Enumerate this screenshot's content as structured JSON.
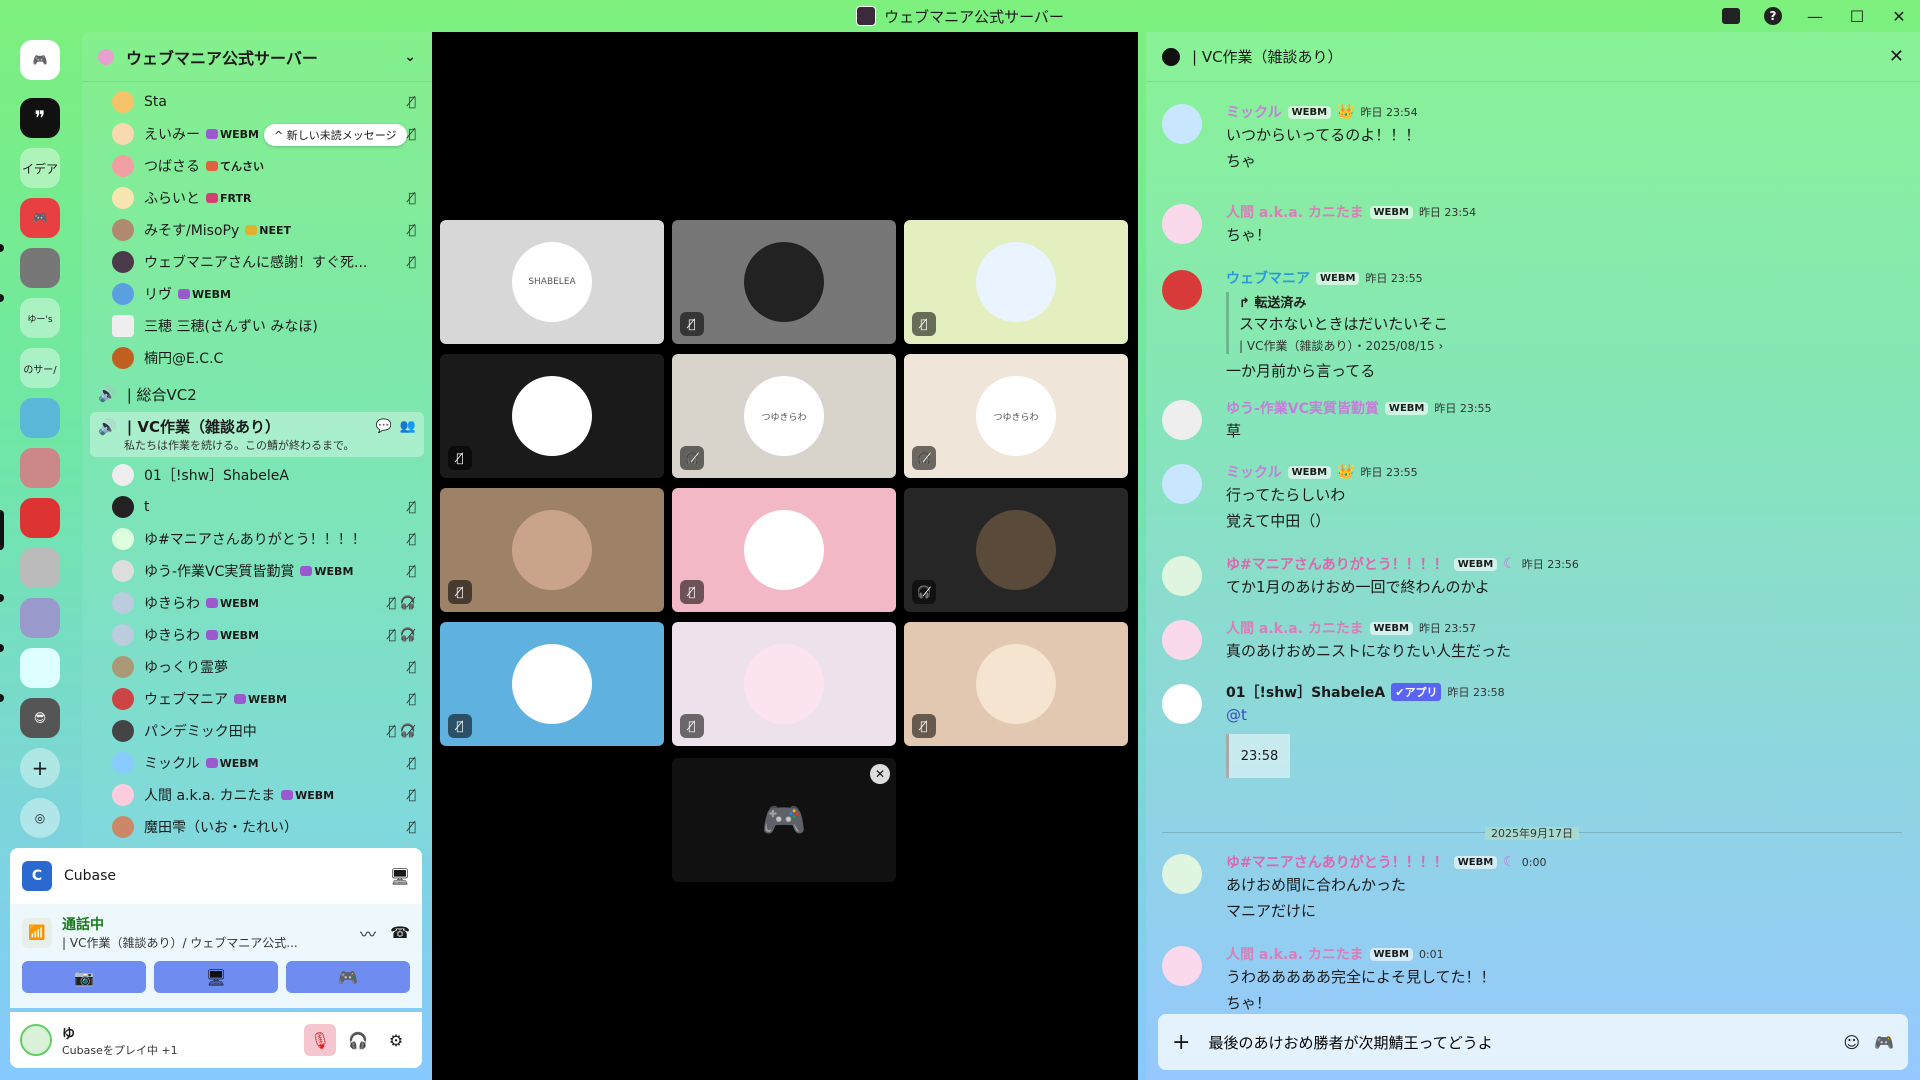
{
  "window": {
    "title": "ウェブマニア公式サーバー"
  },
  "rail": {
    "items": [
      "イデア",
      "ゆー's",
      "のサー/"
    ]
  },
  "server": {
    "name": "ウェブマニア公式サーバー",
    "new_messages_pill": "新しい未読メッセージ",
    "members_top": [
      {
        "name": "Sta",
        "tag": ""
      },
      {
        "name": "えいみー",
        "tag": "WEBM"
      },
      {
        "name": "つばさる",
        "tag": "てんさい"
      },
      {
        "name": "ふらいと",
        "tag": "FRTR"
      },
      {
        "name": "みそす/MisoPy",
        "tag": "NEET"
      },
      {
        "name": "ウェブマニアさんに感謝！すぐ死...",
        "tag": ""
      },
      {
        "name": "リヴ",
        "tag": "WEBM"
      },
      {
        "name": "三穂 三穂(さんずい みなほ)",
        "tag": ""
      },
      {
        "name": "楠円@E.C.C",
        "tag": ""
      }
    ],
    "vc_general": "| 総合VC2",
    "vc_active": {
      "name": "| VC作業（雑談あり）",
      "subtitle": "私たちは作業を続ける。この鯖が終わるまで。"
    },
    "vc_members": [
      {
        "name": "01［!shw］ShabeleA",
        "tag": ""
      },
      {
        "name": "t",
        "tag": ""
      },
      {
        "name": "ゆ#マニアさんありがとう！！！！",
        "tag": ""
      },
      {
        "name": "ゆう-作業VC実質皆勤賞",
        "tag": "WEBM"
      },
      {
        "name": "ゆきらわ",
        "tag": "WEBM"
      },
      {
        "name": "ゆきらわ",
        "tag": "WEBM"
      },
      {
        "name": "ゆっくり霊夢",
        "tag": ""
      },
      {
        "name": "ウェブマニア",
        "tag": "WEBM"
      },
      {
        "name": "パンデミック田中",
        "tag": ""
      },
      {
        "name": "ミックル",
        "tag": "WEBM"
      },
      {
        "name": "人間 a.k.a. カニたま",
        "tag": "WEBM"
      },
      {
        "name": "魔田雫（いお・たれい）",
        "tag": ""
      }
    ]
  },
  "activity": {
    "app_name": "Cubase",
    "status": "通話中",
    "location": "| VC作業（雑談あり）/ ウェブマニア公式...",
    "user_name": "ゆ",
    "user_sub": "Cubaseをプレイ中 +1"
  },
  "stage": {
    "tile1_label": "SHABELEA",
    "tile5_label": "つゆきらわ",
    "tile6_label": "つゆきらわ"
  },
  "chat": {
    "channel": "| VC作業（雑談あり）",
    "messages": [
      {
        "user": "ミックル",
        "badge": "WEBM",
        "time": "昨日 23:54",
        "lines": [
          "いつからいってるのよ！！！",
          "ちゃ"
        ]
      },
      {
        "user": "人間 a.k.a. カニたま",
        "badge": "WEBM",
        "time": "昨日 23:54",
        "lines": [
          "ちゃ！"
        ]
      },
      {
        "user": "ウェブマニア",
        "badge": "WEBM",
        "time": "昨日 23:55",
        "forward_label": "転送済み",
        "forward_text": "スマホないときはだいたいそこ",
        "forward_src": "| VC作業（雑談あり）・2025/08/15",
        "lines": [
          "一か月前から言ってる"
        ]
      },
      {
        "user": "ゆう-作業VC実質皆勤賞",
        "badge": "WEBM",
        "time": "昨日 23:55",
        "lines": [
          "草"
        ]
      },
      {
        "user": "ミックル",
        "badge": "WEBM",
        "time": "昨日 23:55",
        "lines": [
          "行ってたらしいわ",
          "覚えて中田（）"
        ]
      },
      {
        "user": "ゆ#マニアさんありがとう！！！！",
        "badge": "WEBM",
        "time": "昨日 23:56",
        "lines": [
          "てか1月のあけおめ一回で終わんのかよ"
        ]
      },
      {
        "user": "人間 a.k.a. カニたま",
        "badge": "WEBM",
        "time": "昨日 23:57",
        "lines": [
          "真のあけおめニストになりたい人生だった"
        ]
      },
      {
        "user": "01［!shw］ShabeleA",
        "badge": "アプリ",
        "time": "昨日 23:58",
        "mention": "@t",
        "embed": "23:58"
      },
      {
        "user": "ゆ#マニアさんありがとう！！！！",
        "badge": "WEBM",
        "time": "0:00",
        "lines": [
          "あけおめ間に合わんかった",
          "マニアだけに"
        ]
      },
      {
        "user": "人間 a.k.a. カニたま",
        "badge": "WEBM",
        "time": "0:01",
        "lines": [
          "うわあああああ完全によそ見してた！！",
          "ちゃ！"
        ]
      }
    ],
    "date_divider": "2025年9月17日",
    "composer_text": "最後のあけおめ勝者が次期鯖王ってどうよ"
  },
  "colors": {
    "accent": "#5865f2",
    "stage_bg": "#000000"
  }
}
